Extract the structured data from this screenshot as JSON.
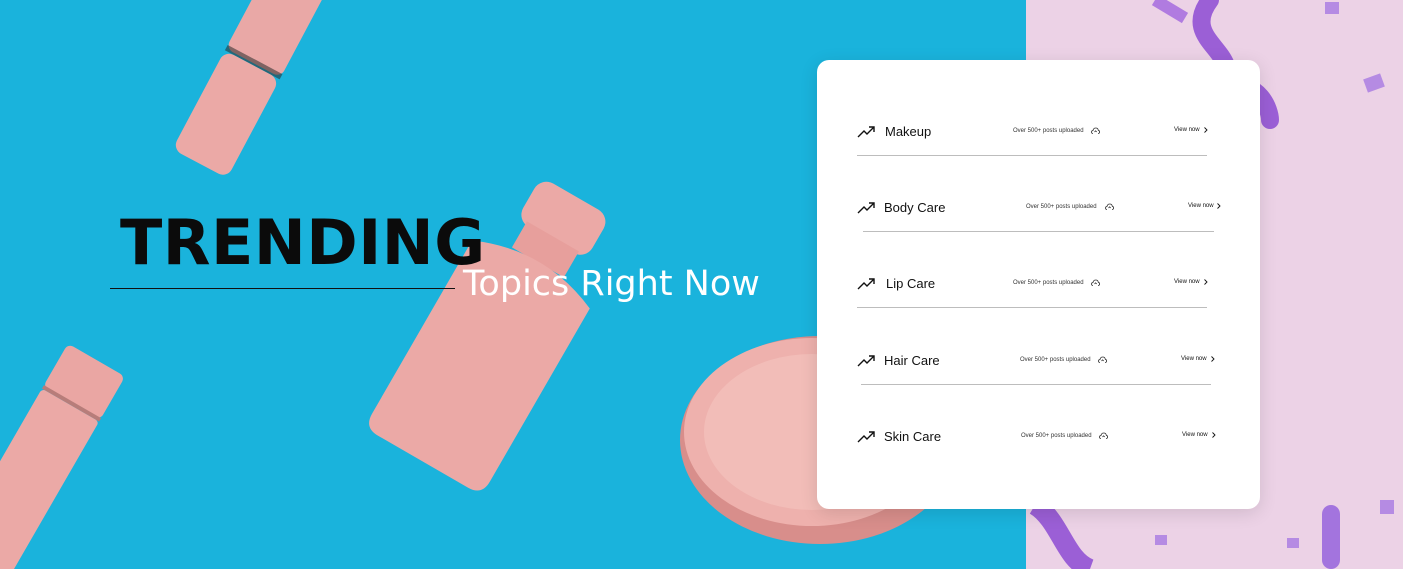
{
  "banner": {
    "heading": "TRENDING",
    "subheading": "Topics Right Now"
  },
  "topics": [
    {
      "name": "Makeup",
      "meta": "Over 500+ posts uploaded",
      "action": "View now"
    },
    {
      "name": "Body Care",
      "meta": "Over 500+ posts uploaded",
      "action": "View now"
    },
    {
      "name": "Lip Care",
      "meta": "Over 500+ posts uploaded",
      "action": "View now"
    },
    {
      "name": "Hair Care",
      "meta": "Over 500+ posts uploaded",
      "action": "View now"
    },
    {
      "name": "Skin Care",
      "meta": "Over 500+ posts uploaded",
      "action": "View now"
    }
  ],
  "colors": {
    "background_left": "#1ab3dc",
    "background_right": "#ecd2e6",
    "product_pink": "#eaa9a4",
    "ribbon_purple": "#9b5fd6"
  }
}
